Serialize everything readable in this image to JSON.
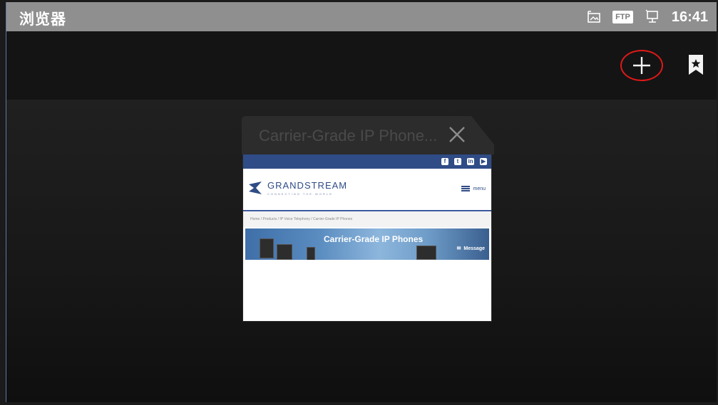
{
  "statusbar": {
    "app_title": "浏览器",
    "icons": [
      "screenshot-icon",
      "ftp-icon",
      "network-icon"
    ],
    "ftp_label": "FTP",
    "time": "16:41"
  },
  "toolbar": {
    "icons": [
      "add-tab-icon",
      "bookmark-icon"
    ]
  },
  "tab": {
    "title": "Carrier-Grade IP Phone...",
    "preview": {
      "logo": "GRANDSTREAM",
      "logo_tagline": "CONNECTING THE WORLD",
      "menu_label": "menu",
      "breadcrumb": "Home  /  Products  /  IP Voice Telephony  /  Carrier-Grade IP Phones",
      "banner_title": "Carrier-Grade IP Phones",
      "message_label": "Message",
      "social_icons": [
        "facebook-icon",
        "twitter-icon",
        "linkedin-icon",
        "youtube-icon"
      ]
    }
  },
  "colors": {
    "statusbar_bg": "#8f8f8f",
    "highlight_circle": "#e01818",
    "site_blue": "#2f4c86"
  }
}
